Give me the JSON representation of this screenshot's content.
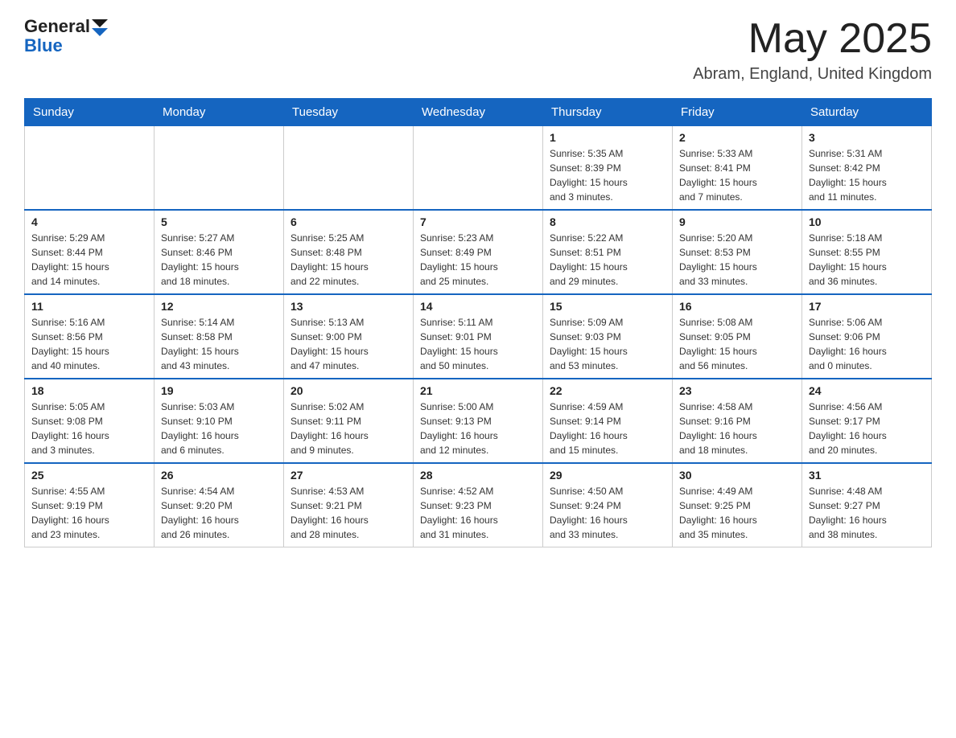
{
  "header": {
    "logo_general": "General",
    "logo_blue": "Blue",
    "month_title": "May 2025",
    "location": "Abram, England, United Kingdom"
  },
  "calendar": {
    "days_of_week": [
      "Sunday",
      "Monday",
      "Tuesday",
      "Wednesday",
      "Thursday",
      "Friday",
      "Saturday"
    ],
    "weeks": [
      {
        "cells": [
          {
            "day": "",
            "info": ""
          },
          {
            "day": "",
            "info": ""
          },
          {
            "day": "",
            "info": ""
          },
          {
            "day": "",
            "info": ""
          },
          {
            "day": "1",
            "info": "Sunrise: 5:35 AM\nSunset: 8:39 PM\nDaylight: 15 hours\nand 3 minutes."
          },
          {
            "day": "2",
            "info": "Sunrise: 5:33 AM\nSunset: 8:41 PM\nDaylight: 15 hours\nand 7 minutes."
          },
          {
            "day": "3",
            "info": "Sunrise: 5:31 AM\nSunset: 8:42 PM\nDaylight: 15 hours\nand 11 minutes."
          }
        ]
      },
      {
        "cells": [
          {
            "day": "4",
            "info": "Sunrise: 5:29 AM\nSunset: 8:44 PM\nDaylight: 15 hours\nand 14 minutes."
          },
          {
            "day": "5",
            "info": "Sunrise: 5:27 AM\nSunset: 8:46 PM\nDaylight: 15 hours\nand 18 minutes."
          },
          {
            "day": "6",
            "info": "Sunrise: 5:25 AM\nSunset: 8:48 PM\nDaylight: 15 hours\nand 22 minutes."
          },
          {
            "day": "7",
            "info": "Sunrise: 5:23 AM\nSunset: 8:49 PM\nDaylight: 15 hours\nand 25 minutes."
          },
          {
            "day": "8",
            "info": "Sunrise: 5:22 AM\nSunset: 8:51 PM\nDaylight: 15 hours\nand 29 minutes."
          },
          {
            "day": "9",
            "info": "Sunrise: 5:20 AM\nSunset: 8:53 PM\nDaylight: 15 hours\nand 33 minutes."
          },
          {
            "day": "10",
            "info": "Sunrise: 5:18 AM\nSunset: 8:55 PM\nDaylight: 15 hours\nand 36 minutes."
          }
        ]
      },
      {
        "cells": [
          {
            "day": "11",
            "info": "Sunrise: 5:16 AM\nSunset: 8:56 PM\nDaylight: 15 hours\nand 40 minutes."
          },
          {
            "day": "12",
            "info": "Sunrise: 5:14 AM\nSunset: 8:58 PM\nDaylight: 15 hours\nand 43 minutes."
          },
          {
            "day": "13",
            "info": "Sunrise: 5:13 AM\nSunset: 9:00 PM\nDaylight: 15 hours\nand 47 minutes."
          },
          {
            "day": "14",
            "info": "Sunrise: 5:11 AM\nSunset: 9:01 PM\nDaylight: 15 hours\nand 50 minutes."
          },
          {
            "day": "15",
            "info": "Sunrise: 5:09 AM\nSunset: 9:03 PM\nDaylight: 15 hours\nand 53 minutes."
          },
          {
            "day": "16",
            "info": "Sunrise: 5:08 AM\nSunset: 9:05 PM\nDaylight: 15 hours\nand 56 minutes."
          },
          {
            "day": "17",
            "info": "Sunrise: 5:06 AM\nSunset: 9:06 PM\nDaylight: 16 hours\nand 0 minutes."
          }
        ]
      },
      {
        "cells": [
          {
            "day": "18",
            "info": "Sunrise: 5:05 AM\nSunset: 9:08 PM\nDaylight: 16 hours\nand 3 minutes."
          },
          {
            "day": "19",
            "info": "Sunrise: 5:03 AM\nSunset: 9:10 PM\nDaylight: 16 hours\nand 6 minutes."
          },
          {
            "day": "20",
            "info": "Sunrise: 5:02 AM\nSunset: 9:11 PM\nDaylight: 16 hours\nand 9 minutes."
          },
          {
            "day": "21",
            "info": "Sunrise: 5:00 AM\nSunset: 9:13 PM\nDaylight: 16 hours\nand 12 minutes."
          },
          {
            "day": "22",
            "info": "Sunrise: 4:59 AM\nSunset: 9:14 PM\nDaylight: 16 hours\nand 15 minutes."
          },
          {
            "day": "23",
            "info": "Sunrise: 4:58 AM\nSunset: 9:16 PM\nDaylight: 16 hours\nand 18 minutes."
          },
          {
            "day": "24",
            "info": "Sunrise: 4:56 AM\nSunset: 9:17 PM\nDaylight: 16 hours\nand 20 minutes."
          }
        ]
      },
      {
        "cells": [
          {
            "day": "25",
            "info": "Sunrise: 4:55 AM\nSunset: 9:19 PM\nDaylight: 16 hours\nand 23 minutes."
          },
          {
            "day": "26",
            "info": "Sunrise: 4:54 AM\nSunset: 9:20 PM\nDaylight: 16 hours\nand 26 minutes."
          },
          {
            "day": "27",
            "info": "Sunrise: 4:53 AM\nSunset: 9:21 PM\nDaylight: 16 hours\nand 28 minutes."
          },
          {
            "day": "28",
            "info": "Sunrise: 4:52 AM\nSunset: 9:23 PM\nDaylight: 16 hours\nand 31 minutes."
          },
          {
            "day": "29",
            "info": "Sunrise: 4:50 AM\nSunset: 9:24 PM\nDaylight: 16 hours\nand 33 minutes."
          },
          {
            "day": "30",
            "info": "Sunrise: 4:49 AM\nSunset: 9:25 PM\nDaylight: 16 hours\nand 35 minutes."
          },
          {
            "day": "31",
            "info": "Sunrise: 4:48 AM\nSunset: 9:27 PM\nDaylight: 16 hours\nand 38 minutes."
          }
        ]
      }
    ]
  }
}
